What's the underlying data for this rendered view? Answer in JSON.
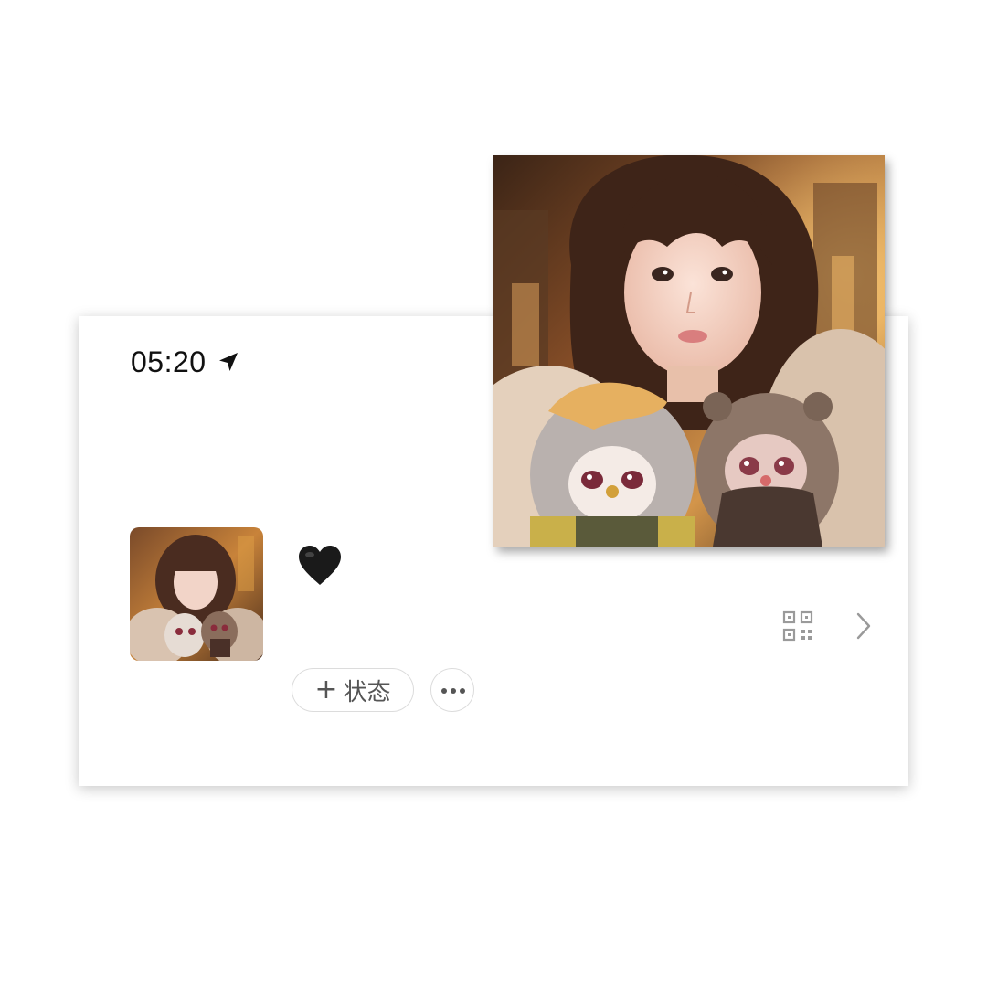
{
  "status_bar": {
    "time": "05:20",
    "location_icon": "location-arrow-icon"
  },
  "profile": {
    "avatar_icon": "profile-avatar-photo",
    "nickname": "🖤",
    "qr_icon": "qr-code-icon",
    "chevron_icon": "chevron-right-icon"
  },
  "actions": {
    "status_plus": "+",
    "status_label": "状态",
    "more_icon": "more-dots-icon"
  },
  "overlay_photo": {
    "icon": "large-portrait-photo"
  },
  "colors": {
    "background": "#ffffff",
    "text_primary": "#111111",
    "text_secondary": "#555555",
    "border": "#dcdcdc",
    "icon_gray": "#9a9a9a"
  }
}
